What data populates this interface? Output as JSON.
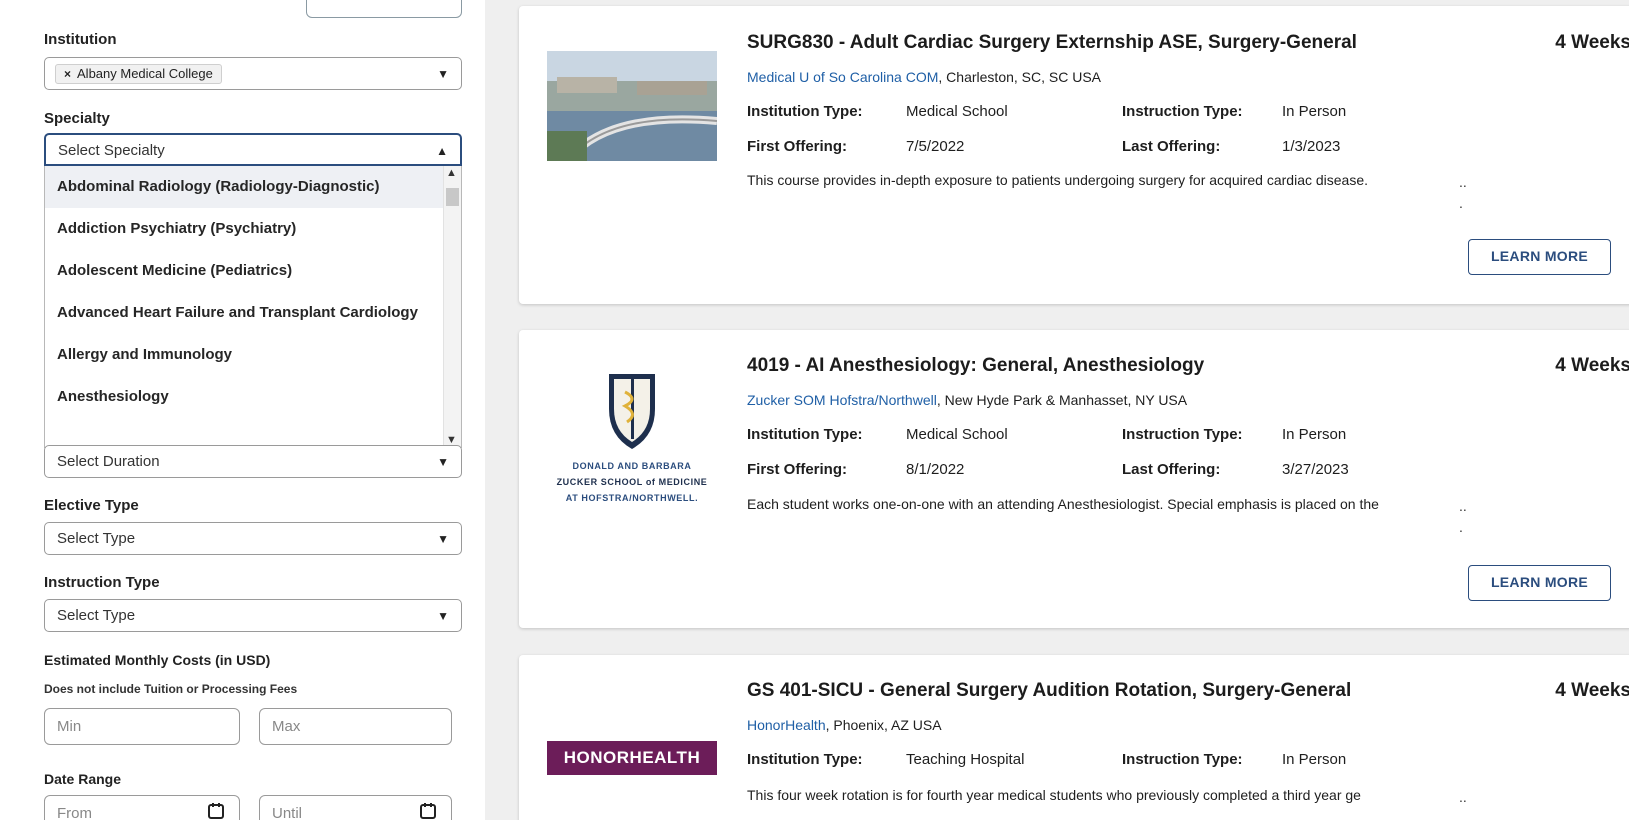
{
  "filters": {
    "institution": {
      "label": "Institution",
      "chip": "Albany Medical College"
    },
    "specialty": {
      "label": "Specialty",
      "placeholder": "Select Specialty",
      "options": [
        "Abdominal Radiology (Radiology-Diagnostic)",
        "Addiction Psychiatry (Psychiatry)",
        "Adolescent Medicine (Pediatrics)",
        "Advanced Heart Failure and Transplant Cardiology",
        "Allergy and Immunology",
        "Anesthesiology"
      ]
    },
    "duration": {
      "placeholder": "Select Duration"
    },
    "elective_type": {
      "label": "Elective Type",
      "placeholder": "Select Type"
    },
    "instruction_type": {
      "label": "Instruction Type",
      "placeholder": "Select Type"
    },
    "costs": {
      "label": "Estimated Monthly Costs (in USD)",
      "sub": "Does not include Tuition or Processing Fees",
      "min": "Min",
      "max": "Max"
    },
    "date_range": {
      "label": "Date Range",
      "from": "From",
      "until": "Until"
    }
  },
  "labels": {
    "institution_type": "Institution Type:",
    "instruction_type": "Instruction Type:",
    "first_offering": "First Offering:",
    "last_offering": "Last Offering:",
    "learn_more": "LEARN MORE",
    "ellipsis": "..\n."
  },
  "courses": [
    {
      "title": "SURG830 - Adult Cardiac Surgery Externship ASE, Surgery-General",
      "duration": "4 Weeks",
      "institution": "Medical U of So Carolina COM",
      "location": ", Charleston, SC, SC USA",
      "institution_type": "Medical School",
      "instruction_type": "In Person",
      "first_offering": "7/5/2022",
      "last_offering": "1/3/2023",
      "description": "This course provides in-depth exposure to patients undergoing surgery for acquired cardiac disease."
    },
    {
      "title": "4019 - AI Anesthesiology: General, Anesthesiology",
      "duration": "4 Weeks",
      "institution": "Zucker SOM Hofstra/Northwell",
      "location": ", New Hyde Park & Manhasset, NY USA",
      "institution_type": "Medical School",
      "instruction_type": "In Person",
      "first_offering": "8/1/2022",
      "last_offering": "3/27/2023",
      "description": "Each student works one-on-one with an attending Anesthesiologist. Special emphasis is placed on the",
      "logo_lines": [
        "DONALD AND BARBARA",
        "ZUCKER SCHOOL of MEDICINE",
        "AT HOFSTRA/NORTHWELL."
      ]
    },
    {
      "title": "GS 401-SICU - General Surgery Audition Rotation, Surgery-General",
      "duration": "4 Weeks",
      "institution": "HonorHealth",
      "location": ", Phoenix, AZ USA",
      "institution_type": "Teaching Hospital",
      "instruction_type": "In Person",
      "description": "This four week rotation is for fourth year medical students who previously completed a third year ge",
      "logo": "HONORHEALTH"
    }
  ],
  "colors": {
    "accent": "#2b4d7e",
    "link": "#1f5fa6",
    "honor": "#6c1d59"
  }
}
